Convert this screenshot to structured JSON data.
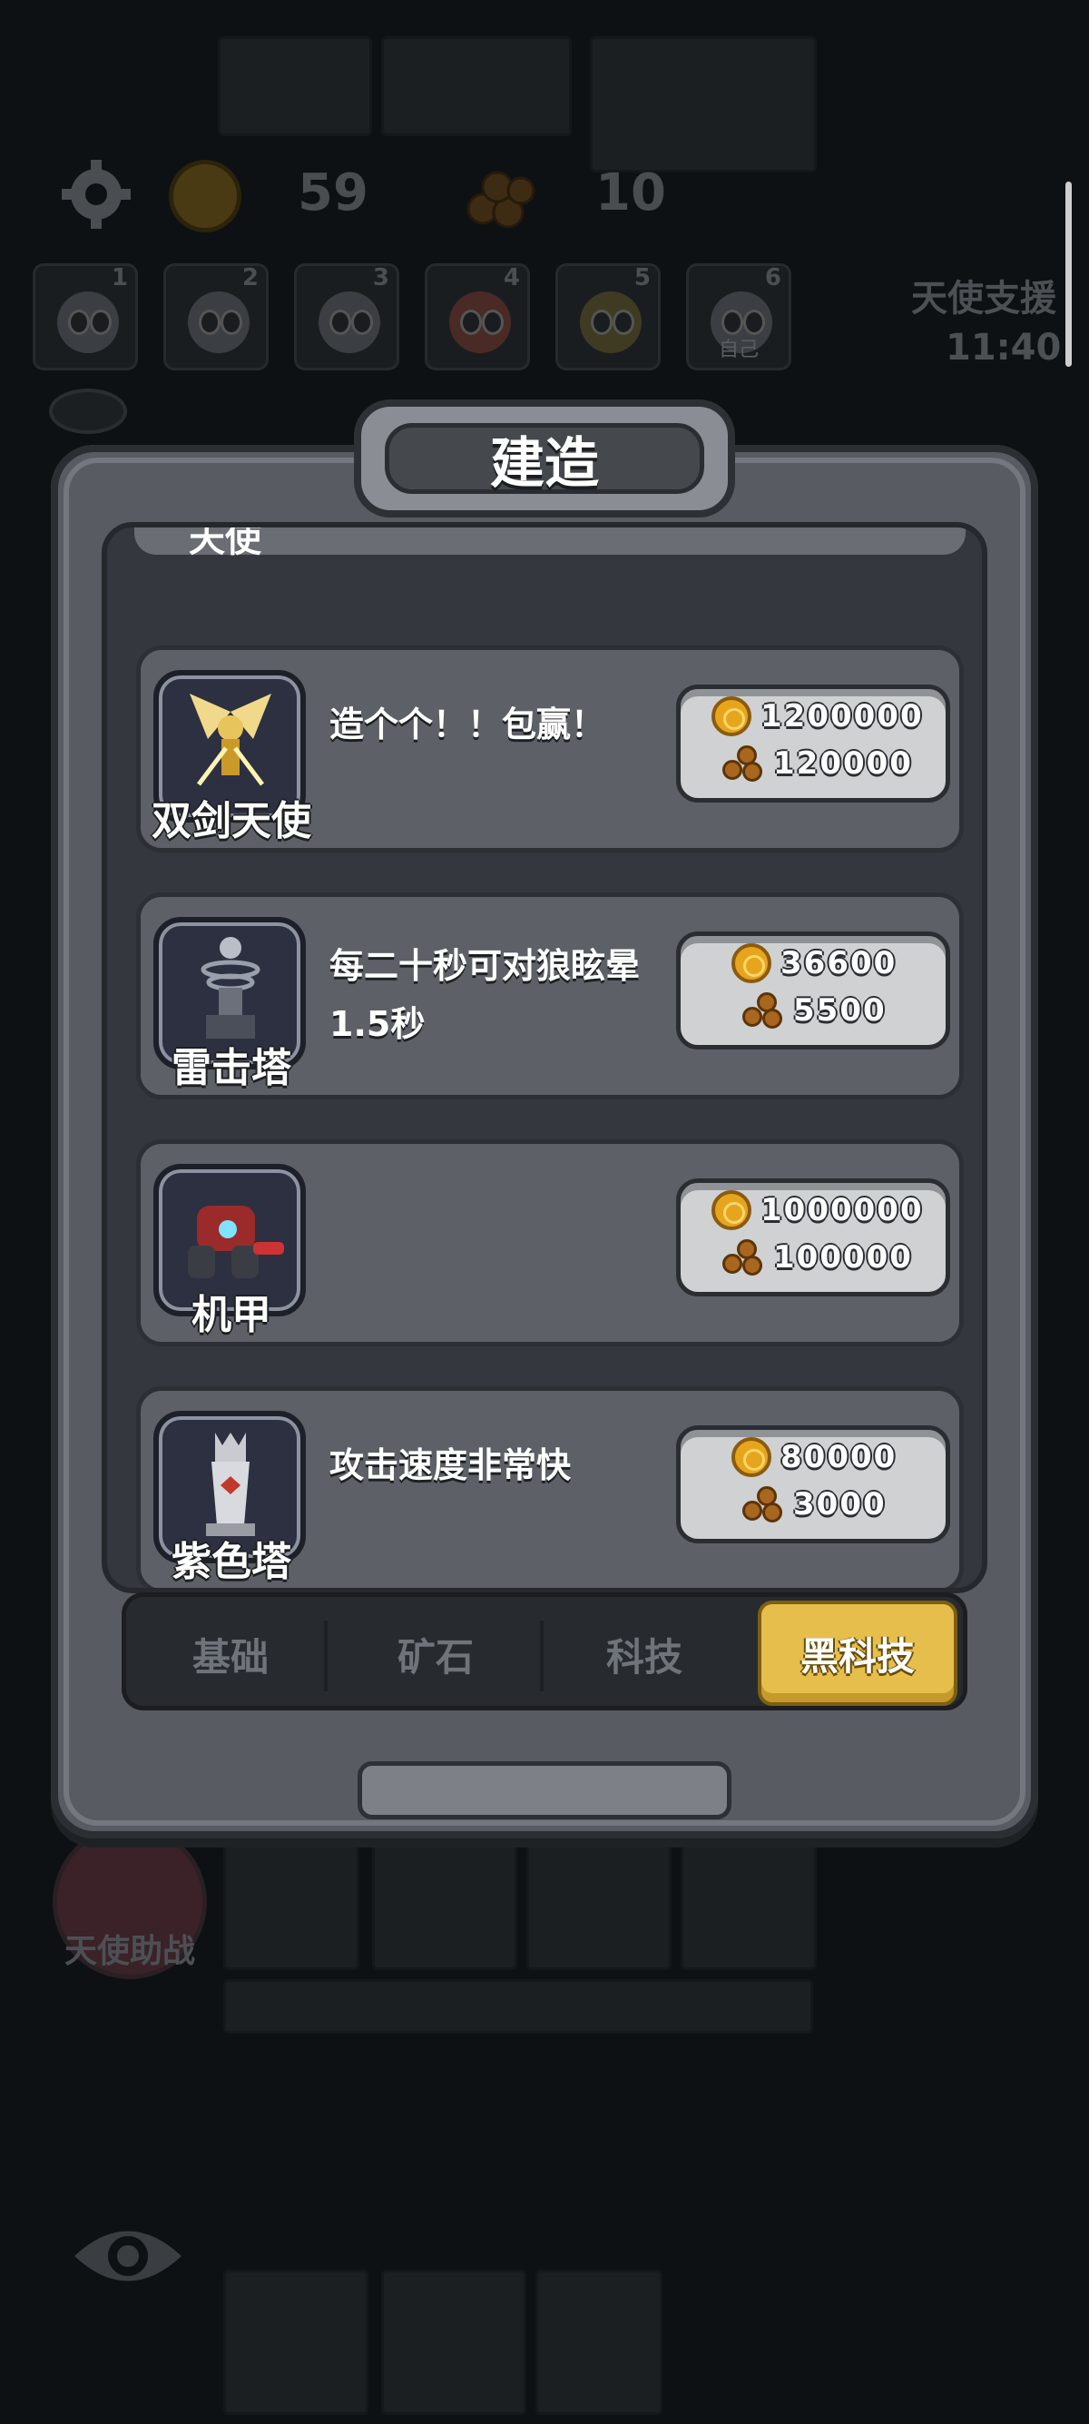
{
  "hud": {
    "gold_count": "59",
    "wood_count": "10",
    "support_label": "天使支援",
    "timer": "11:40",
    "angel_help_label": "天使助战",
    "self_label": "自己",
    "slots": [
      "1",
      "2",
      "3",
      "4",
      "5",
      "6"
    ]
  },
  "panel": {
    "title": "建造",
    "partial_item_name": "天使",
    "items": [
      {
        "name": "双剑天使",
        "desc": "造个个！！包赢！",
        "gold": "1200000",
        "wood": "120000",
        "icon": "twin-sword-angel-icon"
      },
      {
        "name": "雷击塔",
        "desc": "每二十秒可对狼眩晕1.5秒",
        "gold": "36600",
        "wood": "5500",
        "icon": "lightning-tower-icon"
      },
      {
        "name": "机甲",
        "desc": "",
        "gold": "1000000",
        "wood": "100000",
        "icon": "mech-icon"
      },
      {
        "name": "紫色塔",
        "desc": "攻击速度非常快",
        "gold": "80000",
        "wood": "3000",
        "icon": "purple-tower-icon"
      }
    ],
    "tabs": [
      {
        "label": "基础",
        "active": false
      },
      {
        "label": "矿石",
        "active": false
      },
      {
        "label": "科技",
        "active": false
      },
      {
        "label": "黑科技",
        "active": true
      }
    ]
  },
  "colors": {
    "active_tab": "#e6be4c",
    "panel_stone": "#585c62",
    "coin": "#e7a51d",
    "wood": "#a8661e"
  }
}
